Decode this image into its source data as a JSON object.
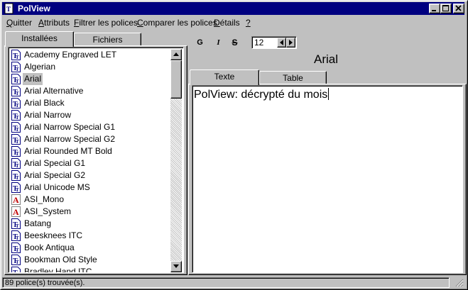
{
  "window": {
    "title": "PolView"
  },
  "menu": [
    {
      "label": "Quitter"
    },
    {
      "label": "Attributs"
    },
    {
      "label": "Filtrer les polices"
    },
    {
      "label": "Comparer les polices"
    },
    {
      "label": "Détails"
    },
    {
      "label": "?"
    }
  ],
  "left_tabs": [
    {
      "label": "Installées",
      "active": true
    },
    {
      "label": "Fichiers",
      "active": false
    }
  ],
  "font_list": [
    {
      "name": "Academy Engraved LET",
      "icon": "truetype-icon"
    },
    {
      "name": "Algerian",
      "icon": "truetype-icon"
    },
    {
      "name": "Arial",
      "icon": "truetype-icon",
      "selected": true
    },
    {
      "name": "Arial Alternative",
      "icon": "truetype-icon"
    },
    {
      "name": "Arial Black",
      "icon": "truetype-icon"
    },
    {
      "name": "Arial Narrow",
      "icon": "truetype-icon"
    },
    {
      "name": "Arial Narrow Special G1",
      "icon": "truetype-icon"
    },
    {
      "name": "Arial Narrow Special G2",
      "icon": "truetype-icon"
    },
    {
      "name": "Arial Rounded MT Bold",
      "icon": "truetype-icon"
    },
    {
      "name": "Arial Special G1",
      "icon": "truetype-icon"
    },
    {
      "name": "Arial Special G2",
      "icon": "truetype-icon"
    },
    {
      "name": "Arial Unicode MS",
      "icon": "truetype-icon"
    },
    {
      "name": "ASI_Mono",
      "icon": "raster-font-icon"
    },
    {
      "name": "ASI_System",
      "icon": "raster-font-icon"
    },
    {
      "name": "Batang",
      "icon": "truetype-icon"
    },
    {
      "name": "Beesknees ITC",
      "icon": "truetype-icon"
    },
    {
      "name": "Book Antiqua",
      "icon": "truetype-icon"
    },
    {
      "name": "Bookman Old Style",
      "icon": "truetype-icon"
    },
    {
      "name": "Bradley Hand ITC",
      "icon": "truetype-icon"
    }
  ],
  "toolbar": {
    "bold": "G",
    "italic": "I",
    "strike": "S",
    "size": "12"
  },
  "preview": {
    "font_name": "Arial",
    "tabs": [
      {
        "label": "Texte",
        "active": true
      },
      {
        "label": "Table",
        "active": false
      }
    ],
    "text": "PolView: décrypté du mois"
  },
  "status": {
    "text": "89 police(s) trouvée(s)."
  },
  "colors": {
    "titlebar": "#000080",
    "face": "#c0c0c0",
    "selection": "#c0c0c0"
  }
}
